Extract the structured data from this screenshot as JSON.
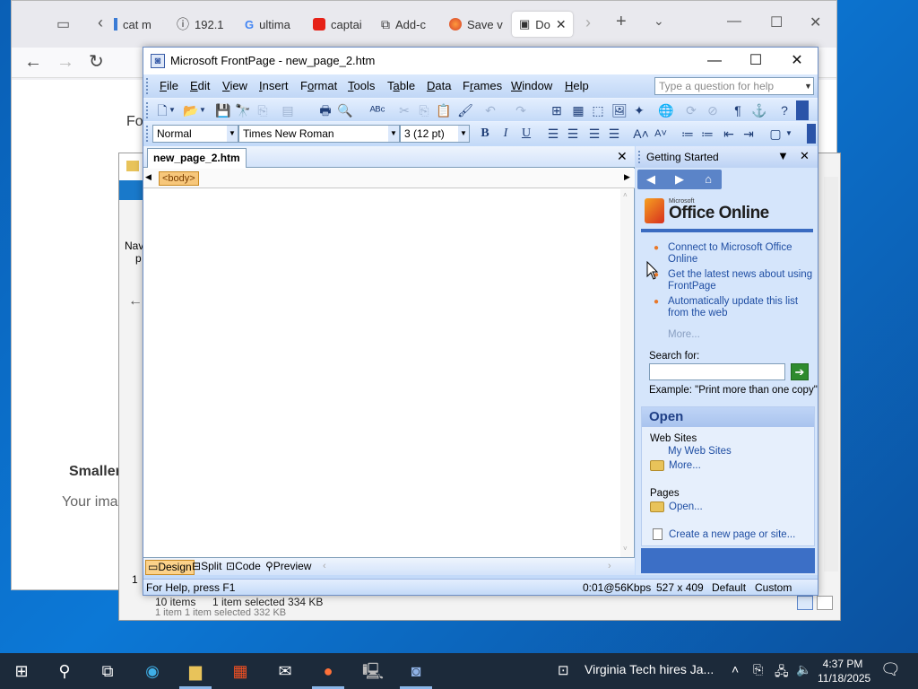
{
  "browser": {
    "tabs": [
      {
        "label": "cat m",
        "icon": "generic-favicon-icon"
      },
      {
        "label": "192.1",
        "icon": "info-icon"
      },
      {
        "label": "ultima",
        "icon": "google-icon"
      },
      {
        "label": "captai",
        "icon": "youtube-icon"
      },
      {
        "label": "Add-c",
        "icon": "puzzle-icon"
      },
      {
        "label": "Save v",
        "icon": "firefox-icon"
      },
      {
        "label": "Do",
        "icon": "document-icon"
      }
    ],
    "content_text_1": "Fo",
    "content_text_2": "Smaller",
    "content_text_3": "Your ima"
  },
  "explorer": {
    "nav_label": "Navi",
    "nav_label_2": "p",
    "status_items": "10 items",
    "status_selected": "1 item selected  334 KB",
    "status_back": "1 item     1 item selected  332 KB",
    "left_number": "1"
  },
  "frontpage": {
    "title": "Microsoft FrontPage - new_page_2.htm",
    "menu": [
      {
        "label": "File",
        "key": "F"
      },
      {
        "label": "Edit",
        "key": "E"
      },
      {
        "label": "View",
        "key": "V"
      },
      {
        "label": "Insert",
        "key": "I"
      },
      {
        "label": "Format",
        "key": "o"
      },
      {
        "label": "Tools",
        "key": "T"
      },
      {
        "label": "Table",
        "key": "a"
      },
      {
        "label": "Data",
        "key": "D"
      },
      {
        "label": "Frames",
        "key": "r"
      },
      {
        "label": "Window",
        "key": "W"
      },
      {
        "label": "Help",
        "key": "H"
      }
    ],
    "help_placeholder": "Type a question for help",
    "style_value": "Normal",
    "font_value": "Times New Roman",
    "size_value": "3  (12 pt)",
    "doc_tab": "new_page_2.htm",
    "body_tag": "<body>",
    "views": [
      "Design",
      "Split",
      "Code",
      "Preview"
    ],
    "status": {
      "help": "For Help, press F1",
      "speed": "0:01@56Kbps",
      "dims": "527 x 409",
      "mode": "Default",
      "custom": "Custom"
    }
  },
  "taskpane": {
    "title": "Getting Started",
    "logo_small": "Microsoft",
    "logo_big": "Office Online",
    "links": [
      "Connect to Microsoft Office Online",
      "Get the latest news about using FrontPage",
      "Automatically update this list from the web"
    ],
    "more": "More...",
    "search_label": "Search for:",
    "example": "Example:  \"Print more than one copy\"",
    "open_head": "Open",
    "web_sites_label": "Web Sites",
    "my_web_sites": "My Web Sites",
    "web_more": "More...",
    "pages_label": "Pages",
    "pages_open": "Open...",
    "create_new": "Create a new page or site..."
  },
  "taskbar": {
    "news": "Virginia Tech hires Ja...",
    "time": "4:37 PM",
    "date": "11/18/2025"
  },
  "colors": {
    "fp_chrome": "#c3daf9",
    "taskpane_link": "#1f4ea3",
    "body_tag_bg": "#f7c77b",
    "taskbar": "#1c2a3a"
  }
}
